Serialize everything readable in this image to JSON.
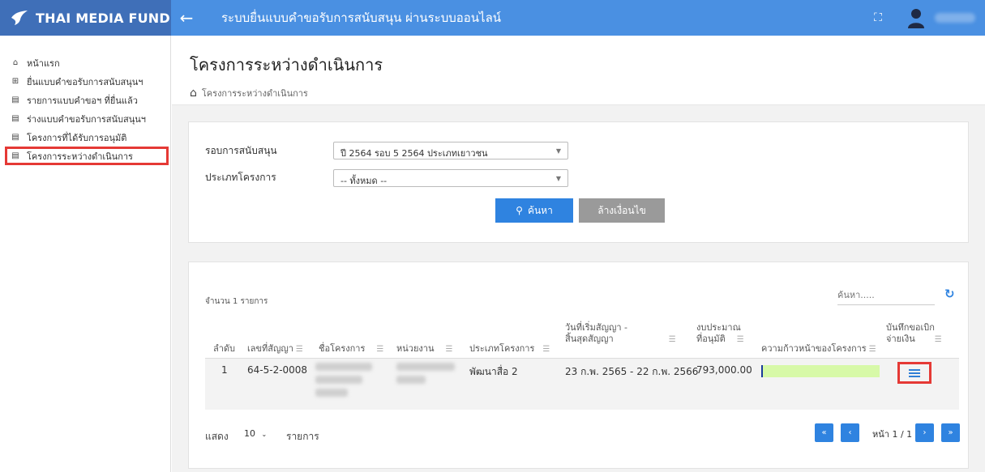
{
  "topbar": {
    "brand": "THAI MEDIA FUND",
    "back_icon": "arrow-left-icon",
    "title": "ระบบยื่นแบบคำขอรับการสนับสนุน ผ่านระบบออนไลน์",
    "fullscreen_icon": "⛶",
    "brand_color": "#3f6fb8",
    "bar_color": "#4a90e2"
  },
  "sidebar": {
    "items": [
      {
        "label": "หน้าแรก",
        "icon": "home-icon"
      },
      {
        "label": "ยื่นแบบคำขอรับการสนับสนุนฯ",
        "icon": "plus-square-icon"
      },
      {
        "label": "รายการแบบคำขอฯ ที่ยื่นแล้ว",
        "icon": "book-icon"
      },
      {
        "label": "ร่างแบบคำขอรับการสนับสนุนฯ",
        "icon": "book-icon"
      },
      {
        "label": "โครงการที่ได้รับการอนุมัติ",
        "icon": "book-icon"
      },
      {
        "label": "โครงการระหว่างดำเนินการ",
        "icon": "book-icon"
      }
    ]
  },
  "page": {
    "title": "โครงการระหว่างดำเนินการ",
    "breadcrumb": "โครงการระหว่างดำเนินการ"
  },
  "search": {
    "round_label": "รอบการสนับสนุน",
    "round_value": "ปี 2564 รอบ 5 2564 ประเภทเยาวชน",
    "type_label": "ประเภทโครงการ",
    "type_value": "-- ทั้งหมด --",
    "search_button": "ค้นหา",
    "clear_button": "ล้างเงื่อนไข"
  },
  "table": {
    "count_text": "จำนวน 1 รายการ",
    "search_placeholder": "ค้นหา.....",
    "headers": {
      "order": "ลำดับ",
      "contract_no": "เลขที่สัญญา",
      "project_name": "ชื่อโครงการ",
      "agency": "หน่วยงาน",
      "project_type": "ประเภทโครงการ",
      "contract_date_1": "วันที่เริ่มสัญญา -",
      "contract_date_2": "สิ้นสุดสัญญา",
      "budget_1": "งบประมาณ",
      "budget_2": "ที่อนุมัติ",
      "progress": "ความก้าวหน้าของโครงการ",
      "payment_1": "บันทึกขอเบิก",
      "payment_2": "จ่ายเงิน"
    },
    "rows": [
      {
        "order": "1",
        "contract_no": "64-5-2-0008",
        "project_type": "พัฒนาสื่อ 2",
        "contract_period": "23 ก.พ. 2565 - 22 ก.พ. 2566",
        "budget": "793,000.00",
        "progress_percent": 0
      }
    ],
    "show_label": "แสดง",
    "page_size": "10",
    "page_size_unit": "รายการ",
    "page_info": "หน้า 1 / 1"
  }
}
